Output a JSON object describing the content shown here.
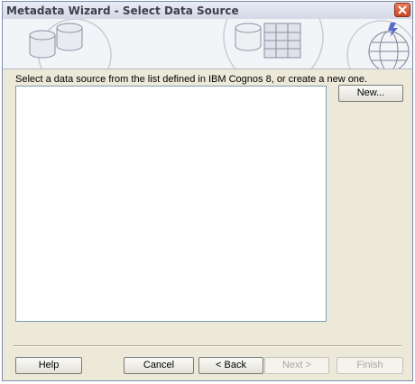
{
  "window": {
    "title": "Metadata Wizard - Select Data Source"
  },
  "main": {
    "instruction": "Select a data source from the list defined in IBM Cognos 8, or create a new one.",
    "data_sources": [],
    "new_button": "New..."
  },
  "footer": {
    "help": "Help",
    "cancel": "Cancel",
    "back": "< Back",
    "next": "Next >",
    "finish": "Finish"
  }
}
